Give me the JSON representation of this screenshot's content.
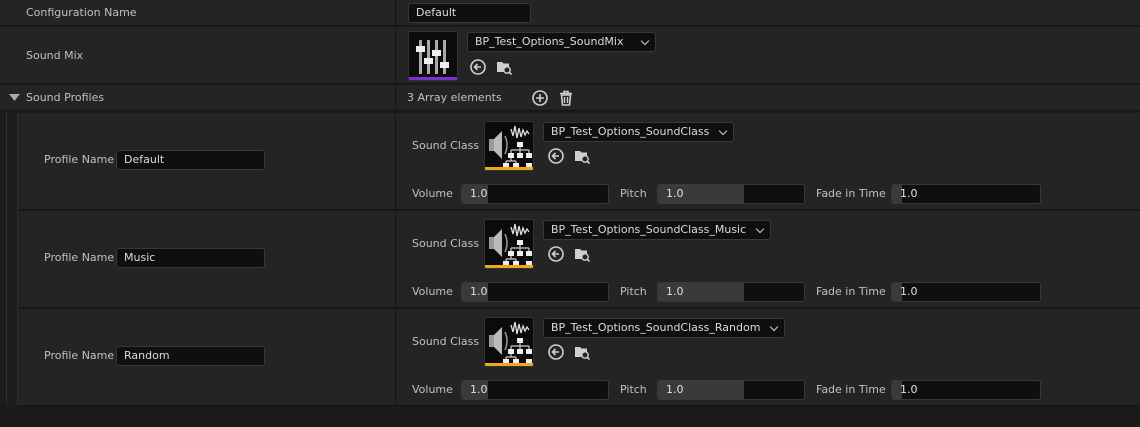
{
  "colors": {
    "sound_mix_accent": "#7b2fd0",
    "sound_class_accent": "#f0a81a"
  },
  "config_name": {
    "label": "Configuration Name",
    "value": "Default"
  },
  "sound_mix": {
    "label": "Sound Mix",
    "asset": "BP_Test_Options_SoundMix",
    "thumbnail_icon": "sound-mix-sliders-icon"
  },
  "sound_profiles": {
    "label": "Sound Profiles",
    "count_text": "3 Array elements",
    "add_icon": "add-element-icon",
    "delete_icon": "trash-icon",
    "items": [
      {
        "profile_name_label": "Profile Name",
        "profile_name": "Default",
        "sound_class_label": "Sound Class",
        "sound_class": "BP_Test_Options_SoundClass",
        "volume_label": "Volume",
        "volume": "1.0",
        "pitch_label": "Pitch",
        "pitch": "1.0",
        "fade_label": "Fade in Time",
        "fade": "1.0"
      },
      {
        "profile_name_label": "Profile Name",
        "profile_name": "Music",
        "sound_class_label": "Sound Class",
        "sound_class": "BP_Test_Options_SoundClass_Music",
        "volume_label": "Volume",
        "volume": "1.0",
        "pitch_label": "Pitch",
        "pitch": "1.0",
        "fade_label": "Fade in Time",
        "fade": "1.0"
      },
      {
        "profile_name_label": "Profile Name",
        "profile_name": "Random",
        "sound_class_label": "Sound Class",
        "sound_class": "BP_Test_Options_SoundClass_Random",
        "volume_label": "Volume",
        "volume": "1.0",
        "pitch_label": "Pitch",
        "pitch": "1.0",
        "fade_label": "Fade in Time",
        "fade": "1.0"
      }
    ]
  }
}
